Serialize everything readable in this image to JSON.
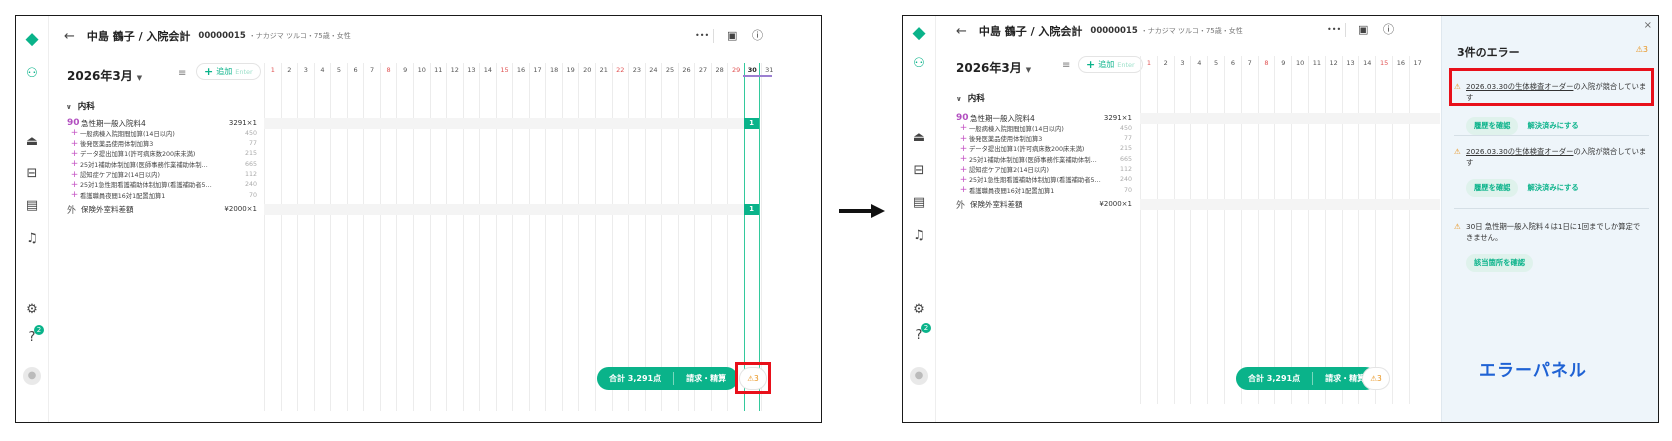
{
  "patient": {
    "name": "中島 鶴子 / 入院会計",
    "id": "00000015",
    "info": "・ナカジマ ツルコ・75歳・女性"
  },
  "toolbar": {
    "more_label": "•••"
  },
  "calendar": {
    "month": "2026年3月",
    "add_label": "追加",
    "add_shortcut": "Enter",
    "days": [
      "1",
      "2",
      "3",
      "4",
      "5",
      "6",
      "7",
      "8",
      "9",
      "10",
      "11",
      "12",
      "13",
      "14",
      "15",
      "16",
      "17",
      "18",
      "19",
      "20",
      "21",
      "22",
      "23",
      "24",
      "25",
      "26",
      "27",
      "28",
      "29",
      "30",
      "31"
    ],
    "red_days": [
      1,
      8,
      15,
      22,
      29
    ],
    "today": 30
  },
  "section": {
    "label": "内科"
  },
  "items": [
    {
      "prefix": "90",
      "name": "急性期一般入院料4",
      "value": "3291×1",
      "day_mark": "1"
    },
    {
      "prefix": "+",
      "name": "一般病棟入院期間加算(14日以内)",
      "value": "450"
    },
    {
      "prefix": "+",
      "name": "後発医薬品使用体制加算3",
      "value": "77"
    },
    {
      "prefix": "+",
      "name": "データ提出加算1(許可病床数200床未満)",
      "value": "215"
    },
    {
      "prefix": "+",
      "name": "25対1補助体制加算(医師事務作業補助体制…",
      "value": "665"
    },
    {
      "prefix": "+",
      "name": "認知症ケア加算2(14日以内)",
      "value": "112"
    },
    {
      "prefix": "+",
      "name": "25対1急性期看護補助体制加算(看護補助者5…",
      "value": "240"
    },
    {
      "prefix": "+",
      "name": "看護職員夜間16対1配置加算1",
      "value": "70"
    },
    {
      "prefix": "外",
      "name": "保険外室料差額",
      "value": "¥2000×1",
      "day_mark": "1"
    }
  ],
  "footer": {
    "total_label": "合計 3,291点",
    "bill_label": "請求・精算",
    "error_count": "3"
  },
  "error_panel": {
    "title": "3件のエラー",
    "count": "3",
    "label": "エラーパネル",
    "errors": [
      {
        "link": "2026.03.30の生体検査オーダー",
        "text": "の入院が競合しています",
        "primary": "履歴を確認",
        "secondary": "解決済みにする"
      },
      {
        "link": "2026.03.30の生体検査オーダー",
        "text": "の入院が競合しています",
        "primary": "履歴を確認",
        "secondary": "解決済みにする"
      },
      {
        "link": "",
        "text": "30日 急性期一般入院料４は1日に1回までしか算定できません。",
        "primary": "該当箇所を確認",
        "secondary": ""
      }
    ]
  },
  "colors": {
    "accent": "#0ab38a",
    "warning": "#e8921a",
    "highlight": "#e8101a",
    "panel_label": "#1f62d4"
  },
  "icons": {
    "logo": "logo-icon",
    "patients": "patient-search-icon",
    "ward": "ward-icon",
    "bed": "bed-icon",
    "list": "list-icon",
    "bell": "bell-icon",
    "gear": "gear-icon",
    "help": "help-icon",
    "avatar": "avatar-icon",
    "back": "back-arrow-icon",
    "more": "more-icon",
    "calendar": "calendar-icon",
    "info": "info-icon",
    "filter": "filter-icon",
    "warning": "warning-icon"
  }
}
